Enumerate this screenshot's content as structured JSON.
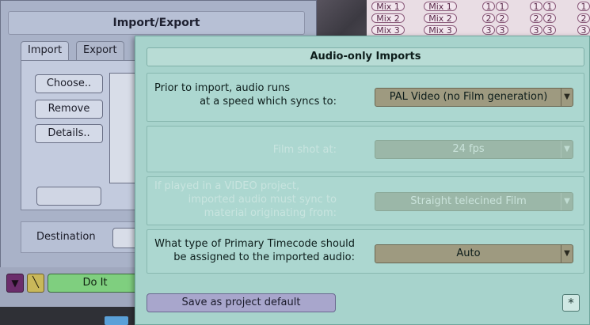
{
  "import_export": {
    "title": "Import/Export",
    "tabs": [
      {
        "label": "Import"
      },
      {
        "label": "Export"
      }
    ],
    "buttons": {
      "choose": "Choose..",
      "remove": "Remove",
      "details": "Details.."
    },
    "destination_label": "Destination",
    "do_it_label": "Do It"
  },
  "mix_panel": {
    "rows": [
      {
        "labels": [
          "Mix 1",
          "Mix 1"
        ],
        "nums": [
          "1",
          "1",
          "1",
          "1",
          "1"
        ]
      },
      {
        "labels": [
          "Mix 2",
          "Mix 2"
        ],
        "nums": [
          "2",
          "2",
          "2",
          "2",
          "2"
        ]
      },
      {
        "labels": [
          "Mix 3",
          "Mix 3"
        ],
        "nums": [
          "3",
          "3",
          "3",
          "3",
          "3"
        ]
      }
    ]
  },
  "audio_dialog": {
    "title": "Audio-only Imports",
    "row1": {
      "label_line1": "Prior to import, audio runs",
      "label_line2": "at a speed which syncs to:",
      "value": "PAL Video (no Film generation)",
      "enabled": true
    },
    "row2": {
      "label": "Film shot at:",
      "value": "24 fps",
      "enabled": false
    },
    "row3": {
      "label_line1": "If played in a VIDEO project,",
      "label_line2": "imported audio must sync to",
      "label_line3": "material originating from:",
      "value": "Straight telecined Film",
      "enabled": false
    },
    "row4": {
      "label_line1": "What type of Primary Timecode should",
      "label_line2": "be assigned to the imported audio:",
      "value": "Auto",
      "enabled": true
    },
    "save_default_label": "Save as project default",
    "asterisk_label": "*"
  },
  "icons": {
    "select_arrow": "chevron-down-icon",
    "triangle": "triangle-down-icon",
    "wand": "wand-icon",
    "asterisk": "asterisk-icon"
  },
  "colors": {
    "dialog_bg": "#a7d3cc",
    "import_window_bg": "#a9b2c8",
    "do_it_green": "#7fcf7f",
    "save_default_purple": "#a8a6cc"
  }
}
